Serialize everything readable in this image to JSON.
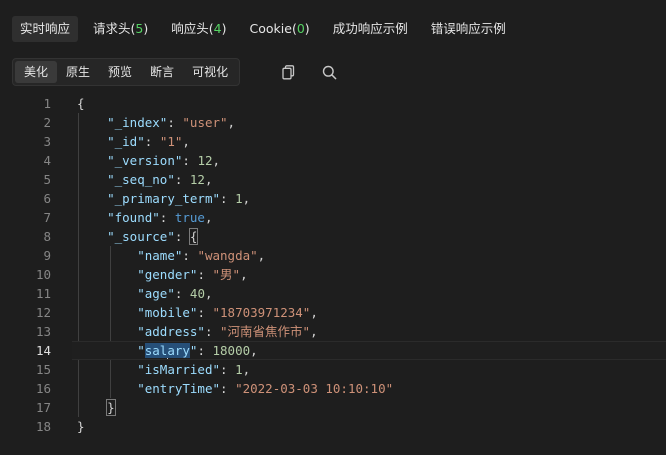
{
  "tabs": [
    {
      "label": "实时响应",
      "count": null,
      "active": true
    },
    {
      "label": "请求头",
      "count": "5",
      "active": false
    },
    {
      "label": "响应头",
      "count": "4",
      "active": false
    },
    {
      "label": "Cookie",
      "count": "0",
      "active": false
    },
    {
      "label": "成功响应示例",
      "count": null,
      "active": false
    },
    {
      "label": "错误响应示例",
      "count": null,
      "active": false
    }
  ],
  "views": [
    {
      "label": "美化",
      "active": true
    },
    {
      "label": "原生",
      "active": false
    },
    {
      "label": "预览",
      "active": false
    },
    {
      "label": "断言",
      "active": false
    },
    {
      "label": "可视化",
      "active": false
    }
  ],
  "icons": {
    "copy": "copy-icon",
    "search": "search-icon"
  },
  "colors": {
    "key": "#9cdcfe",
    "string": "#ce9178",
    "number": "#b5cea8",
    "boolean": "#569cd6",
    "count": "#56d364"
  },
  "editor": {
    "current_line": 14,
    "lines": [
      {
        "n": "1",
        "indent": 0,
        "tokens": [
          {
            "t": "p",
            "v": "{"
          }
        ]
      },
      {
        "n": "2",
        "indent": 1,
        "tokens": [
          {
            "t": "k",
            "v": "\"_index\""
          },
          {
            "t": "p",
            "v": ": "
          },
          {
            "t": "s",
            "v": "\"user\""
          },
          {
            "t": "p",
            "v": ","
          }
        ]
      },
      {
        "n": "3",
        "indent": 1,
        "tokens": [
          {
            "t": "k",
            "v": "\"_id\""
          },
          {
            "t": "p",
            "v": ": "
          },
          {
            "t": "s",
            "v": "\"1\""
          },
          {
            "t": "p",
            "v": ","
          }
        ]
      },
      {
        "n": "4",
        "indent": 1,
        "tokens": [
          {
            "t": "k",
            "v": "\"_version\""
          },
          {
            "t": "p",
            "v": ": "
          },
          {
            "t": "n",
            "v": "12"
          },
          {
            "t": "p",
            "v": ","
          }
        ]
      },
      {
        "n": "5",
        "indent": 1,
        "tokens": [
          {
            "t": "k",
            "v": "\"_seq_no\""
          },
          {
            "t": "p",
            "v": ": "
          },
          {
            "t": "n",
            "v": "12"
          },
          {
            "t": "p",
            "v": ","
          }
        ]
      },
      {
        "n": "6",
        "indent": 1,
        "tokens": [
          {
            "t": "k",
            "v": "\"_primary_term\""
          },
          {
            "t": "p",
            "v": ": "
          },
          {
            "t": "n",
            "v": "1"
          },
          {
            "t": "p",
            "v": ","
          }
        ]
      },
      {
        "n": "7",
        "indent": 1,
        "tokens": [
          {
            "t": "k",
            "v": "\"found\""
          },
          {
            "t": "p",
            "v": ": "
          },
          {
            "t": "b",
            "v": "true"
          },
          {
            "t": "p",
            "v": ","
          }
        ]
      },
      {
        "n": "8",
        "indent": 1,
        "tokens": [
          {
            "t": "k",
            "v": "\"_source\""
          },
          {
            "t": "p",
            "v": ": "
          },
          {
            "t": "p",
            "v": "{",
            "box": true
          }
        ]
      },
      {
        "n": "9",
        "indent": 2,
        "tokens": [
          {
            "t": "k",
            "v": "\"name\""
          },
          {
            "t": "p",
            "v": ": "
          },
          {
            "t": "s",
            "v": "\"wangda\""
          },
          {
            "t": "p",
            "v": ","
          }
        ]
      },
      {
        "n": "10",
        "indent": 2,
        "tokens": [
          {
            "t": "k",
            "v": "\"gender\""
          },
          {
            "t": "p",
            "v": ": "
          },
          {
            "t": "s",
            "v": "\"男\""
          },
          {
            "t": "p",
            "v": ","
          }
        ]
      },
      {
        "n": "11",
        "indent": 2,
        "tokens": [
          {
            "t": "k",
            "v": "\"age\""
          },
          {
            "t": "p",
            "v": ": "
          },
          {
            "t": "n",
            "v": "40"
          },
          {
            "t": "p",
            "v": ","
          }
        ]
      },
      {
        "n": "12",
        "indent": 2,
        "tokens": [
          {
            "t": "k",
            "v": "\"mobile\""
          },
          {
            "t": "p",
            "v": ": "
          },
          {
            "t": "s",
            "v": "\"18703971234\""
          },
          {
            "t": "p",
            "v": ","
          }
        ]
      },
      {
        "n": "13",
        "indent": 2,
        "tokens": [
          {
            "t": "k",
            "v": "\"address\""
          },
          {
            "t": "p",
            "v": ": "
          },
          {
            "t": "s",
            "v": "\"河南省焦作市\""
          },
          {
            "t": "p",
            "v": ","
          }
        ]
      },
      {
        "n": "14",
        "indent": 2,
        "tokens": [
          {
            "t": "k",
            "v": "\""
          },
          {
            "t": "k",
            "v": "sal",
            "sel": true
          },
          {
            "t": "cursor",
            "v": ""
          },
          {
            "t": "k",
            "v": "ary",
            "sel": true
          },
          {
            "t": "k",
            "v": "\""
          },
          {
            "t": "p",
            "v": ": "
          },
          {
            "t": "n",
            "v": "18000"
          },
          {
            "t": "p",
            "v": ","
          }
        ]
      },
      {
        "n": "15",
        "indent": 2,
        "tokens": [
          {
            "t": "k",
            "v": "\"isMarried\""
          },
          {
            "t": "p",
            "v": ": "
          },
          {
            "t": "n",
            "v": "1"
          },
          {
            "t": "p",
            "v": ","
          }
        ]
      },
      {
        "n": "16",
        "indent": 2,
        "tokens": [
          {
            "t": "k",
            "v": "\"entryTime\""
          },
          {
            "t": "p",
            "v": ": "
          },
          {
            "t": "s",
            "v": "\"2022-03-03 10:10:10\""
          }
        ]
      },
      {
        "n": "17",
        "indent": 1,
        "tokens": [
          {
            "t": "p",
            "v": "}",
            "box": true
          }
        ]
      },
      {
        "n": "18",
        "indent": 0,
        "tokens": [
          {
            "t": "p",
            "v": "}"
          }
        ]
      }
    ]
  }
}
